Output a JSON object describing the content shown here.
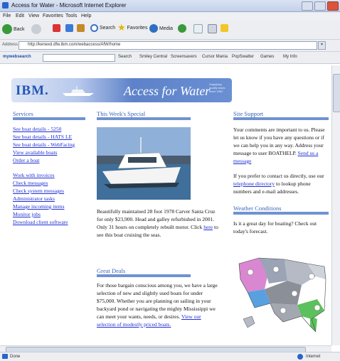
{
  "window": {
    "title": "Access for Water - Microsoft Internet Explorer"
  },
  "menubar": [
    "File",
    "Edit",
    "View",
    "Favorites",
    "Tools",
    "Help"
  ],
  "toolbar": {
    "back_label": "Back",
    "search_label": "Search",
    "favorites_label": "Favorites",
    "media_label": "Media"
  },
  "address": {
    "label": "Address",
    "url": "http://kenexd.dfw.ibm.com/webaccess/AfW/home"
  },
  "searchbar": {
    "brand": "mywebsearch",
    "items": [
      "Search",
      "Smiley Central",
      "Screensavers",
      "Cursor Mania",
      "PopSwatter",
      "Games",
      "My Info"
    ]
  },
  "banner": {
    "logo": "IBM.",
    "title": "Access for Water",
    "tagline": "Supplying quality boats since 1962"
  },
  "services": {
    "heading": "Services",
    "links_a": [
      "See boat details - 5250",
      "See boat details - HATS LE",
      "See boat details - WebFacing",
      "View available boats",
      "Order a boat"
    ],
    "links_b": [
      "Work with invoices",
      "Check messages",
      "Check system messages",
      "Administrator tasks",
      "Manage incoming items",
      "Monitor jobs",
      "Download client software"
    ]
  },
  "special": {
    "heading": "This Week's Special",
    "text_before": "Beautifully maintained 28 foot 1978 Carver Santa Cruz for only $23,900. Head and galley refurbished in 2001. Only 31 hours on completely rebuilt motor. Click ",
    "link": "here",
    "text_after": " to see this boat cruising the seas."
  },
  "deals": {
    "heading": "Great Deals",
    "text": "For those bargain conscious among you, we have a large selection of new and slightly used boats for under $75,000. Whether you are planning on sailing in your backyard pond or navigating the mighty Mississippi we can meet your wants, needs, or desires.",
    "link": "View our selection of modestly priced boats."
  },
  "support": {
    "heading": "Site Support",
    "text1": "Your comments are important to us. Please let us know if you have any questions or if we can help you in any way. Address your message to user BOATHELP.",
    "link1": "Send us a message",
    "text2a": "If you prefer to contact us directly, use our ",
    "link2": "telephone directory",
    "text2b": " to lookup phone numbers and e-mail addresses."
  },
  "weather": {
    "heading": "Weather Conditions",
    "text": "Is it a great day for boating? Check out today's forecast."
  },
  "status": {
    "left": "Done",
    "right": "Internet"
  },
  "colors": {
    "heading": "#3b64b8",
    "link": "#1f2fd0",
    "rule": "#6f92d2"
  }
}
